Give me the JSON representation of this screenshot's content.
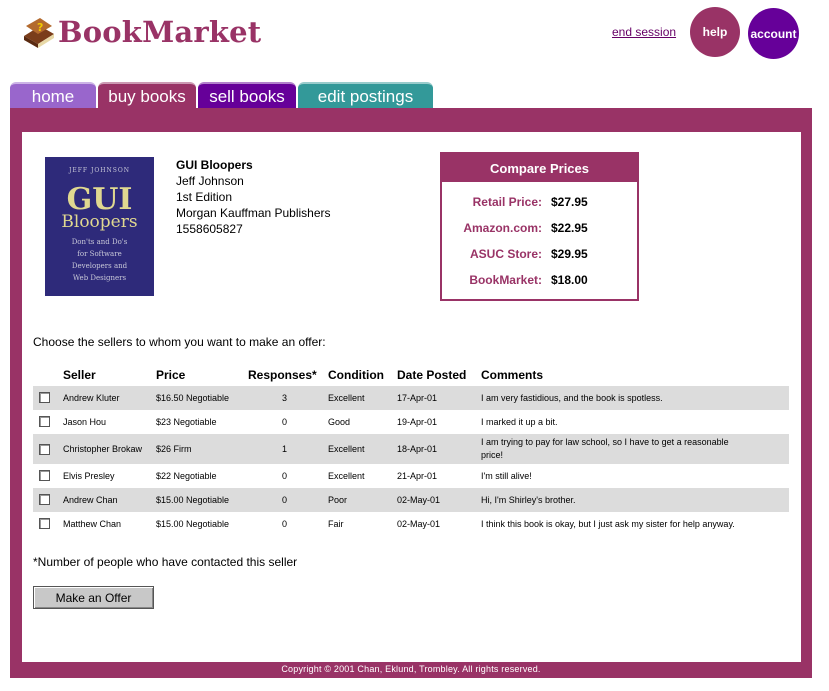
{
  "header": {
    "logo_text": "BookMarket",
    "end_session": "end session",
    "help": "help",
    "account": "account"
  },
  "tabs": [
    {
      "label": "home"
    },
    {
      "label": "buy books"
    },
    {
      "label": "sell books"
    },
    {
      "label": "edit postings"
    }
  ],
  "book": {
    "cover": {
      "author": "JEFF JOHNSON",
      "title_line1": "GUI",
      "title_line2": "Bloopers",
      "subtitle": [
        "Don'ts and Do's",
        "for Software",
        "Developers and",
        "Web Designers"
      ]
    },
    "title": "GUI Bloopers",
    "author": "Jeff Johnson",
    "edition": "1st Edition",
    "publisher": "Morgan Kauffman Publishers",
    "isbn": "1558605827"
  },
  "compare": {
    "heading": "Compare Prices",
    "prices": [
      {
        "label": "Retail Price:",
        "value": "$27.95"
      },
      {
        "label": "Amazon.com:",
        "value": "$22.95"
      },
      {
        "label": "ASUC Store:",
        "value": "$29.95"
      },
      {
        "label": "BookMarket:",
        "value": "$18.00"
      }
    ]
  },
  "choose_text": "Choose the sellers to whom you want to make an offer:",
  "table": {
    "headers": [
      "Seller",
      "Price",
      "Responses*",
      "Condition",
      "Date Posted",
      "Comments"
    ],
    "rows": [
      {
        "seller": "Andrew Kluter",
        "price": "$16.50 Negotiable",
        "responses": "3",
        "condition": "Excellent",
        "date": "17-Apr-01",
        "comment": [
          "I am very fastidious, and the book is spotless."
        ]
      },
      {
        "seller": "Jason Hou",
        "price": "$23 Negotiable",
        "responses": "0",
        "condition": "Good",
        "date": "19-Apr-01",
        "comment": [
          "I marked it up a bit."
        ]
      },
      {
        "seller": "Christopher Brokaw",
        "price": "$26 Firm",
        "responses": "1",
        "condition": "Excellent",
        "date": "18-Apr-01",
        "comment": [
          "I am trying to pay for law school, so I have to get a reasonable",
          "price!"
        ]
      },
      {
        "seller": "Elvis Presley",
        "price": "$22 Negotiable",
        "responses": "0",
        "condition": "Excellent",
        "date": "21-Apr-01",
        "comment": [
          "I'm still alive!"
        ]
      },
      {
        "seller": "Andrew Chan",
        "price": "$15.00 Negotiable",
        "responses": "0",
        "condition": "Poor",
        "date": "02-May-01",
        "comment": [
          "Hi, I'm Shirley's brother."
        ]
      },
      {
        "seller": "Matthew Chan",
        "price": "$15.00 Negotiable",
        "responses": "0",
        "condition": "Fair",
        "date": "02-May-01",
        "comment": [
          "I think this book is okay, but I just ask my sister for help anyway."
        ]
      }
    ]
  },
  "footnote": "*Number of people who have contacted this seller",
  "offer_button": "Make an Offer",
  "copyright": "Copyright © 2001 Chan, Eklund, Trombley. All rights reserved.",
  "colors": {
    "brand": "#993366",
    "purple": "#660099",
    "lavender": "#9966cc",
    "teal": "#339999",
    "row_shade": "#dcdcdc"
  }
}
